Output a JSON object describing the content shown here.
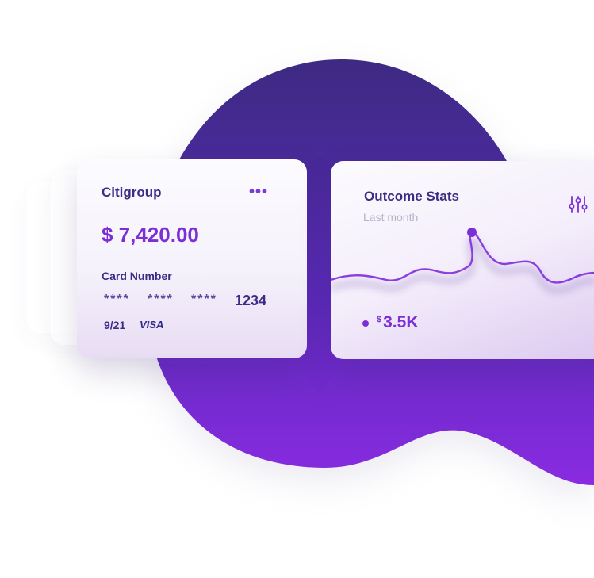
{
  "card": {
    "bank_name": "Citigroup",
    "menu_icon": "more-dots-icon",
    "balance": "$ 7,420.00",
    "number_label": "Card Number",
    "masked_groups": [
      "****",
      "****",
      "****"
    ],
    "last_four": "1234",
    "expiry": "9/21",
    "brand": "VISA"
  },
  "stats": {
    "title": "Outcome Stats",
    "period": "Last month",
    "filter_icon": "sliders-icon",
    "currency": "$",
    "amount": "3.5K"
  },
  "colors": {
    "accent": "#7b2fd4",
    "heading": "#3b2c85",
    "blob_top": "#3d2a82",
    "blob_bottom": "#8a2be2"
  }
}
